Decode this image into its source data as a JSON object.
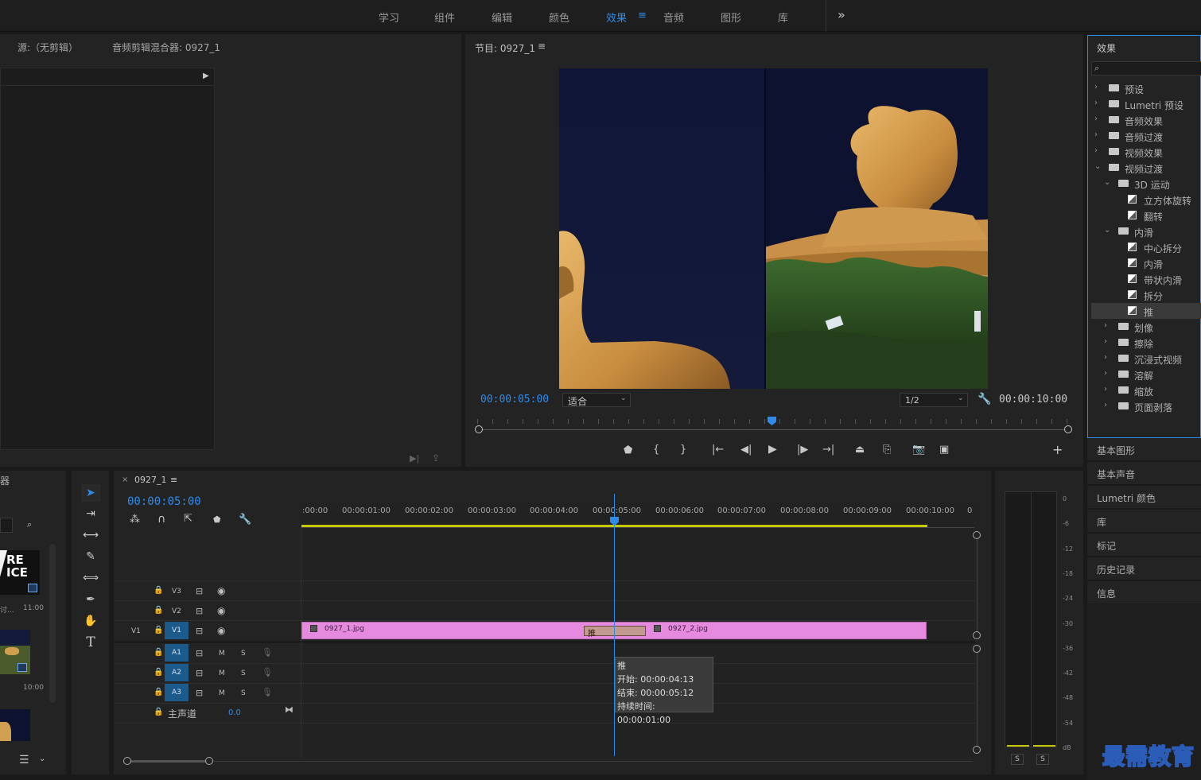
{
  "workspace_tabs": [
    "学习",
    "组件",
    "编辑",
    "颜色",
    "效果",
    "音频",
    "图形",
    "库"
  ],
  "workspace_active": "效果",
  "workspace_menu_icon": "≡",
  "workspace_more": "»",
  "source_panel": {
    "source_tab": "源:（无剪辑）",
    "mixer_tab": "音频剪辑混合器: 0927_1"
  },
  "program_monitor": {
    "title": "节目: 0927_1",
    "menu": "≡",
    "current_time": "00:00:05:00",
    "fit": "适合",
    "resolution": "1/2",
    "duration": "00:00:10:00"
  },
  "effects_panel": {
    "title": "效果",
    "search_placeholder": "",
    "tree": [
      {
        "label": "预设",
        "level": 0,
        "kind": "bin",
        "open": false
      },
      {
        "label": "Lumetri 预设",
        "level": 0,
        "kind": "bin",
        "open": false
      },
      {
        "label": "音频效果",
        "level": 0,
        "kind": "folder",
        "open": false
      },
      {
        "label": "音频过渡",
        "level": 0,
        "kind": "folder",
        "open": false
      },
      {
        "label": "视频效果",
        "level": 0,
        "kind": "folder",
        "open": false
      },
      {
        "label": "视频过渡",
        "level": 0,
        "kind": "folder",
        "open": true
      },
      {
        "label": "3D 运动",
        "level": 1,
        "kind": "folder",
        "open": true
      },
      {
        "label": "立方体旋转",
        "level": 2,
        "kind": "effect"
      },
      {
        "label": "翻转",
        "level": 2,
        "kind": "effect"
      },
      {
        "label": "内滑",
        "level": 1,
        "kind": "folder",
        "open": true
      },
      {
        "label": "中心拆分",
        "level": 2,
        "kind": "effect"
      },
      {
        "label": "内滑",
        "level": 2,
        "kind": "effect"
      },
      {
        "label": "带状内滑",
        "level": 2,
        "kind": "effect"
      },
      {
        "label": "拆分",
        "level": 2,
        "kind": "effect"
      },
      {
        "label": "推",
        "level": 2,
        "kind": "effect",
        "selected": true
      },
      {
        "label": "划像",
        "level": 1,
        "kind": "folder",
        "open": false
      },
      {
        "label": "擦除",
        "level": 1,
        "kind": "folder",
        "open": false
      },
      {
        "label": "沉浸式视频",
        "level": 1,
        "kind": "folder",
        "open": false
      },
      {
        "label": "溶解",
        "level": 1,
        "kind": "folder",
        "open": false
      },
      {
        "label": "缩放",
        "level": 1,
        "kind": "folder",
        "open": false
      },
      {
        "label": "页面剥落",
        "level": 1,
        "kind": "folder",
        "open": false
      }
    ]
  },
  "side_panels": [
    "基本图形",
    "基本声音",
    "Lumetri 颜色",
    "库",
    "标记",
    "历史记录",
    "信息"
  ],
  "project_panel": {
    "title_fragment": "器",
    "thumb1_text": "RE\nICE",
    "thumb1_caption": "讨...",
    "thumb1_duration": "11:00",
    "thumb2_duration": "10:00"
  },
  "timeline": {
    "sequence_tab": "0927_1",
    "close": "×",
    "menu": "≡",
    "current_time": "00:00:05:00",
    "ruler": [
      ":00:00",
      "00:00:01:00",
      "00:00:02:00",
      "00:00:03:00",
      "00:00:04:00",
      "00:00:05:00",
      "00:00:06:00",
      "00:00:07:00",
      "00:00:08:00",
      "00:00:09:00",
      "00:00:10:00",
      "0"
    ],
    "video_tracks": [
      "V3",
      "V2",
      "V1"
    ],
    "v1_source": "V1",
    "audio_tracks": [
      "A1",
      "A2",
      "A3"
    ],
    "mute": "M",
    "solo": "S",
    "master_label": "主声道",
    "master_value": "0.0",
    "clip1": "0927_1.jpg",
    "clip2": "0927_2.jpg",
    "transition_label": "推",
    "tooltip": {
      "name": "推",
      "start": "开始: 00:00:04:13",
      "end": "结束: 00:00:05:12",
      "duration": "持续时间: 00:00:01:00"
    }
  },
  "audio_meter": {
    "labels": [
      "0",
      "-6",
      "-12",
      "-18",
      "-24",
      "-30",
      "-36",
      "-42",
      "-48",
      "-54",
      "dB"
    ],
    "solo_left": "S",
    "solo_right": "S"
  },
  "watermark": "最需教育",
  "colors": {
    "accent": "#2d8ceb",
    "clip": "#e68ae0",
    "transition": "#c39a8f",
    "track_badge": "#1d5a8c",
    "work_area": "#c8c800"
  }
}
